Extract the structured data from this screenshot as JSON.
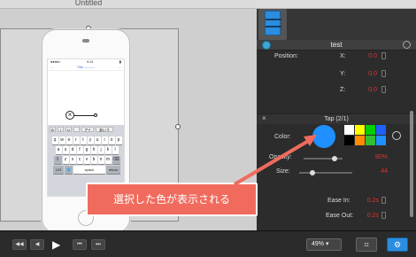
{
  "window": {
    "title": "Untitled"
  },
  "phone": {
    "status_left": "●●●●○",
    "status_center": "9:41",
    "status_right": "▮",
    "nav_left": "←",
    "nav_center": "Title ———",
    "nav_right": "→",
    "toolbar": [
      "B",
      "I",
      "U",
      "",
      "アイ",
      "あいう"
    ],
    "rows": [
      [
        "q",
        "w",
        "e",
        "r",
        "t",
        "y",
        "u",
        "i",
        "o",
        "p"
      ],
      [
        "a",
        "s",
        "d",
        "f",
        "g",
        "h",
        "j",
        "k",
        "l"
      ],
      [
        "z",
        "x",
        "c",
        "v",
        "b",
        "n",
        "m"
      ]
    ],
    "bottom_row": [
      "123",
      "🌐",
      "space",
      "return"
    ]
  },
  "inspector": {
    "object_name": "test",
    "position_label": "Position:",
    "x_label": "X:",
    "x_value": "0.0",
    "y_label": "Y:",
    "y_value": "0.0",
    "z_label": "Z:",
    "z_value": "0.0",
    "section_title": "Tap (2/1)",
    "color_label": "Color:",
    "opacity_label": "Opacity:",
    "opacity_value": "80%",
    "opacity_level": 0.8,
    "size_label": "Size:",
    "size_value": "44",
    "size_level": 0.25,
    "ease_in_label": "Ease In:",
    "ease_in_value": "0.2s",
    "ease_out_label": "Ease Out:",
    "ease_out_value": "0.2s",
    "selected_color": "#1e90ff",
    "swatches": [
      "#ffffff",
      "#ffff00",
      "#00d000",
      "#2060ff",
      "#000000",
      "#ff8c00",
      "#30c030",
      "#1e90ff"
    ]
  },
  "transport": {
    "back": "◀◀",
    "rewind": "◀",
    "play": "▶",
    "prev": "⏮",
    "next": "⏭"
  },
  "footer": {
    "zoom": "49%",
    "crop_icon": "⌗",
    "settings_icon": "⚙"
  },
  "callout": {
    "text": "選択した色が表示される"
  }
}
